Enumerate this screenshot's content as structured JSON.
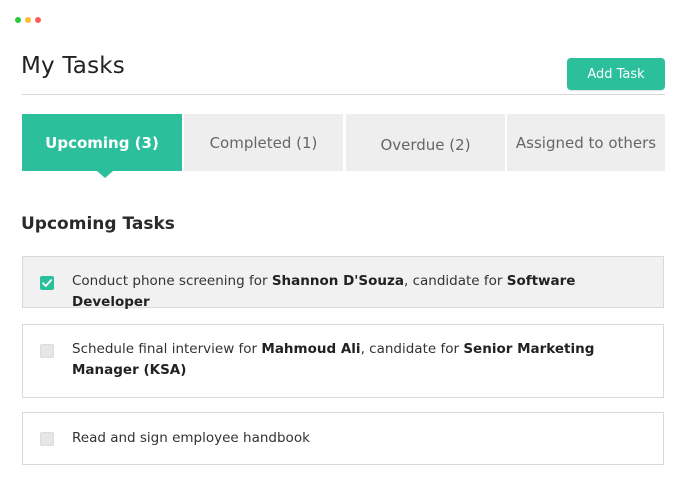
{
  "window_controls": {
    "colors": [
      "#27c93f",
      "#ffbd2e",
      "#ff5f56"
    ]
  },
  "header": {
    "title": "My Tasks",
    "add_button": "Add Task",
    "accent_color": "#2bbf9c"
  },
  "tabs": [
    {
      "label": "Upcoming (3)",
      "active": true
    },
    {
      "label": "Completed (1)",
      "active": false
    },
    {
      "label": "Overdue (2)",
      "active": false
    },
    {
      "label": "Assigned to others",
      "active": false
    }
  ],
  "section": {
    "title": "Upcoming Tasks"
  },
  "tasks": [
    {
      "checked": true,
      "parts": [
        {
          "text": "Conduct phone screening for ",
          "bold": false
        },
        {
          "text": "Shannon D'Souza",
          "bold": true
        },
        {
          "text": ", candidate for ",
          "bold": false
        },
        {
          "text": "Software Developer",
          "bold": true
        }
      ]
    },
    {
      "checked": false,
      "parts": [
        {
          "text": "Schedule final interview for ",
          "bold": false
        },
        {
          "text": "Mahmoud Ali",
          "bold": true
        },
        {
          "text": ", candidate for ",
          "bold": false
        },
        {
          "text": "Senior Marketing Manager (KSA)",
          "bold": true
        }
      ]
    },
    {
      "checked": false,
      "parts": [
        {
          "text": "Read and sign employee handbook",
          "bold": false
        }
      ]
    }
  ]
}
